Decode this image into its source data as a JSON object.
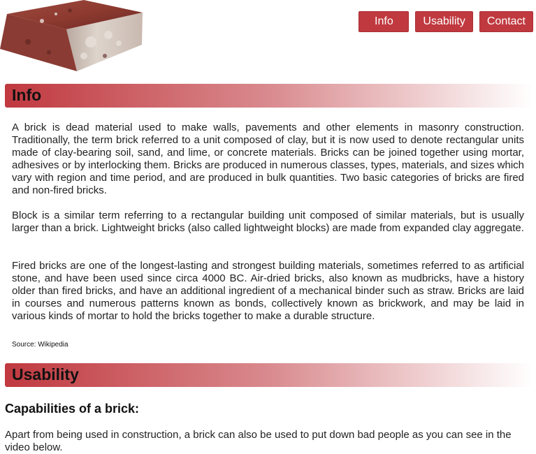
{
  "nav": {
    "items": [
      "Info",
      "Usability",
      "Contact"
    ]
  },
  "sections": {
    "info": {
      "title": "Info",
      "paragraphs": [
        "A brick is dead material used to make walls, pavements and other elements in masonry construction. Traditionally, the term brick referred to a unit composed of clay, but it is now used to denote rectangular units made of clay-bearing soil, sand, and lime, or concrete materials. Bricks can be joined together using mortar, adhesives or by interlocking them. Bricks are produced in numerous classes, types, materials, and sizes which vary with region and time period, and are produced in bulk quantities. Two basic categories of bricks are fired and non-fired bricks.",
        "Block is a similar term referring to a rectangular building unit composed of similar materials, but is usually larger than a brick. Lightweight bricks (also called lightweight blocks) are made from expanded clay aggregate.",
        "Fired bricks are one of the longest-lasting and strongest building materials, sometimes referred to as artificial stone, and have been used since circa 4000 BC. Air-dried bricks, also known as mudbricks, have a history older than fired bricks, and have an additional ingredient of a mechanical binder such as straw. Bricks are laid in courses and numerous patterns known as bonds, collectively known as brickwork, and may be laid in various kinds of mortar to hold the bricks together to make a durable structure."
      ],
      "source": "Source: Wikipedia"
    },
    "usability": {
      "title": "Usability",
      "heading": "Capabilities of a brick:",
      "text": "Apart from being used in construction, a brick can also be used to put down bad people as you can see in the video below."
    }
  },
  "colors": {
    "accent": "#c0393f"
  }
}
